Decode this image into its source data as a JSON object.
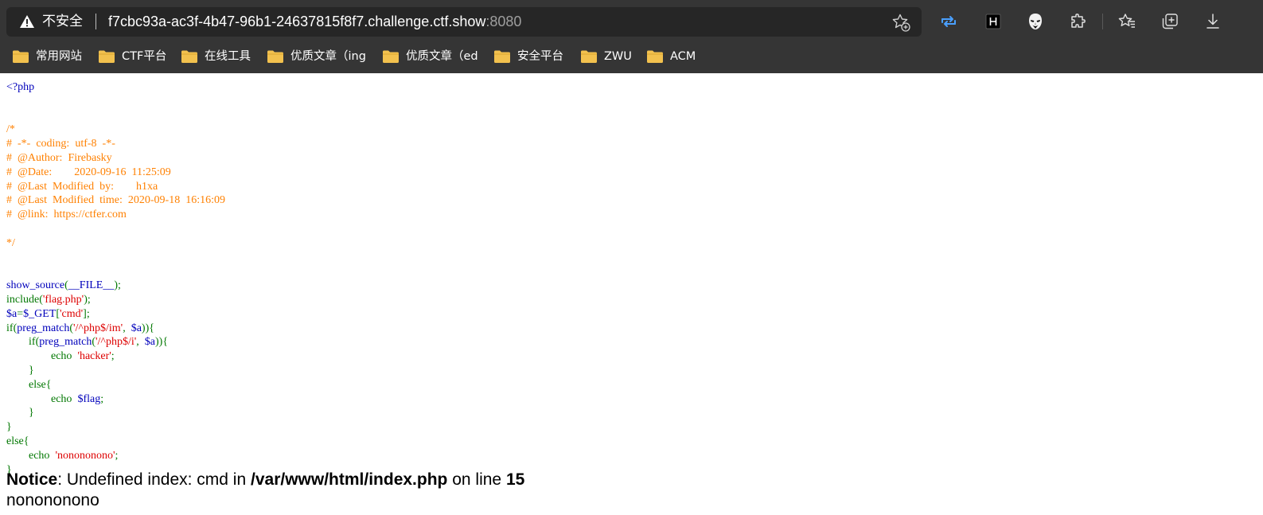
{
  "address_bar": {
    "security_label": "不安全",
    "url_host": "f7cbc93a-ac3f-4b47-96b1-24637815f8f7.challenge.ctf.show",
    "url_port": ":8080"
  },
  "toolbar": {
    "icons": [
      "add-to-favorites-icon",
      "tab-sync-icon",
      "h-extension-icon",
      "mask-extension-icon",
      "extensions-puzzle-icon",
      "favorites-icon",
      "collections-icon",
      "downloads-icon"
    ],
    "accent_color": "#4aa0ff"
  },
  "bookmarks": [
    {
      "label": "常用网站"
    },
    {
      "label": "CTF平台"
    },
    {
      "label": "在线工具"
    },
    {
      "label": "优质文章（ing"
    },
    {
      "label": "优质文章（ed"
    },
    {
      "label": "安全平台"
    },
    {
      "label": "ZWU"
    },
    {
      "label": "ACM"
    }
  ],
  "source": {
    "php_open": "<?php",
    "comment_lines": [
      "/*",
      "#  -*-  coding:  utf-8  -*-",
      "#  @Author:  Firebasky",
      "#  @Date:        2020-09-16  11:25:09",
      "#  @Last  Modified  by:        h1xa",
      "#  @Last  Modified  time:  2020-09-18  16:16:09",
      "#  @link:  https://ctfer.com",
      "",
      "*/"
    ],
    "l_show_fn": "show_source",
    "l_show_arg": "__FILE__",
    "l_include": "include",
    "l_include_arg": "'flag.php'",
    "l_assign_var": "$a",
    "l_get": "$_GET",
    "l_get_key": "'cmd'",
    "l_if1": "if",
    "l_preg1": "preg_match",
    "l_regex1": "'/^php$/im'",
    "l_var_a": "$a",
    "l_if2": "if",
    "l_preg2": "preg_match",
    "l_regex2": "'/^php$/i'",
    "l_echo": "echo",
    "l_hacker": "'hacker'",
    "l_else": "else",
    "l_flag_var": "$flag",
    "l_nonono_str": "'nonononono'",
    "colors": {
      "keyword": "#007700",
      "default": "#0000bb",
      "comment": "#ff8000",
      "string": "#dd0000"
    }
  },
  "notice": {
    "label": "Notice",
    "message": ": Undefined index: cmd in ",
    "path": "/var/www/html/index.php",
    "on_line": " on line ",
    "line": "15"
  },
  "output_text": "nonononono"
}
